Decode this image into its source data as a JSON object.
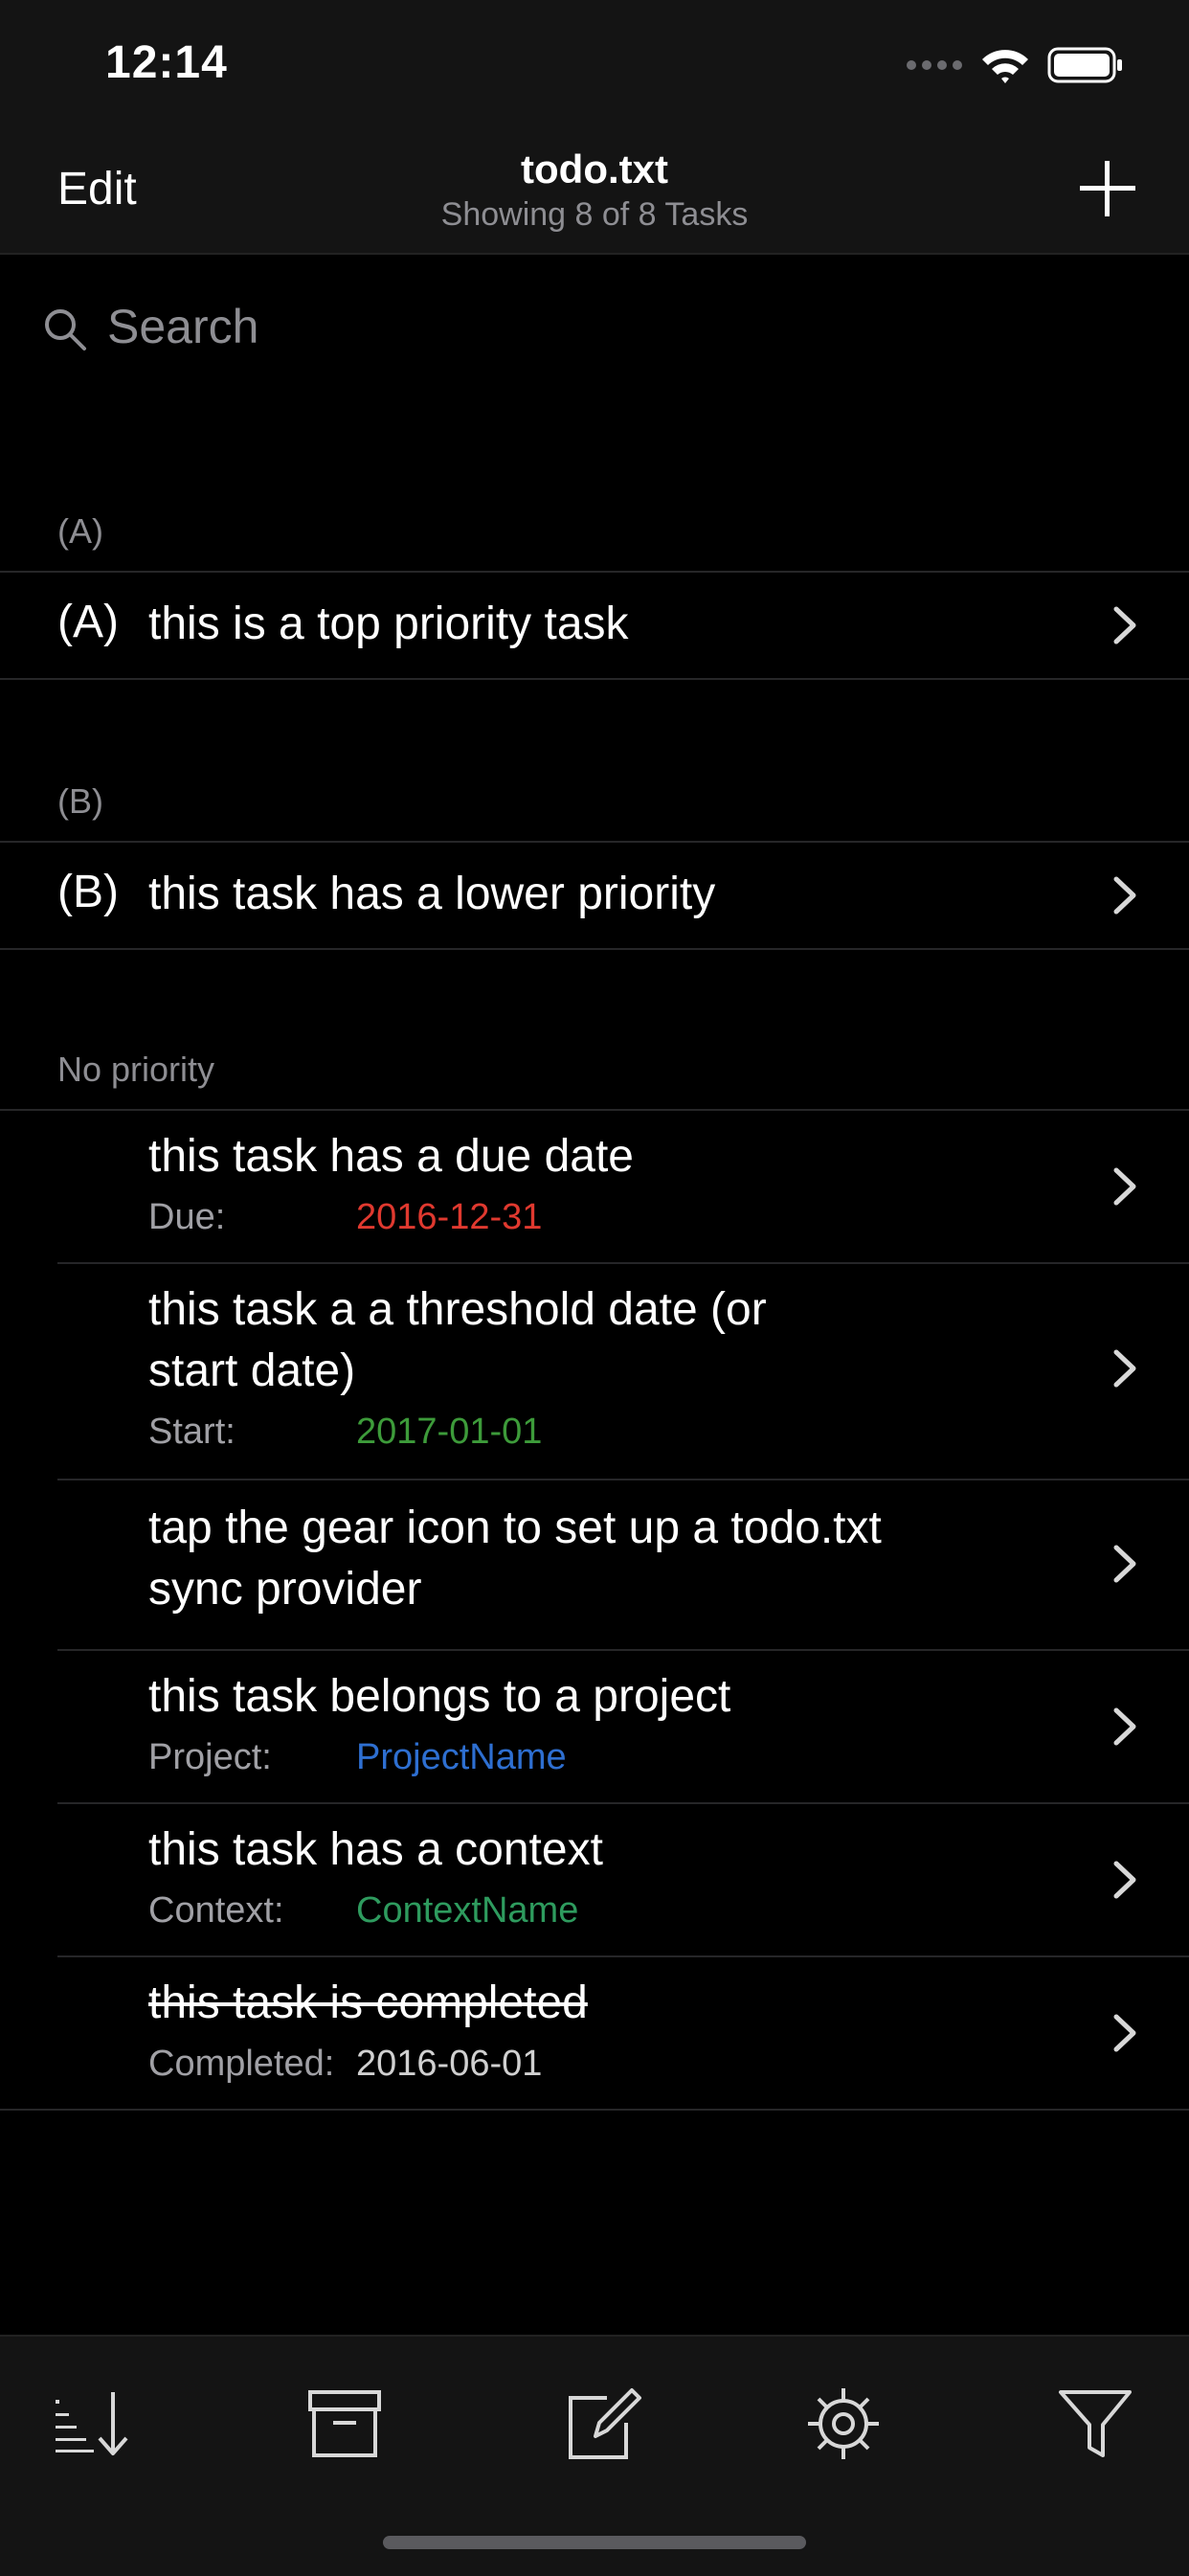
{
  "status_bar": {
    "time": "12:14"
  },
  "nav": {
    "edit_label": "Edit",
    "title": "todo.txt",
    "subtitle": "Showing 8 of 8 Tasks"
  },
  "search": {
    "placeholder": "Search"
  },
  "sections": {
    "a": {
      "header": "(A)",
      "items": [
        {
          "priority": "(A)",
          "text": "this is a top priority task"
        }
      ]
    },
    "b": {
      "header": "(B)",
      "items": [
        {
          "priority": "(B)",
          "text": "this task has a lower priority"
        }
      ]
    },
    "none": {
      "header": "No priority",
      "items": [
        {
          "text": "this task has a due date",
          "meta_label": "Due:",
          "meta_value": "2016-12-31"
        },
        {
          "text_line1": "this task a a threshold date (or",
          "text_line2": "start date)",
          "meta_label": "Start:",
          "meta_value": "2017-01-01"
        },
        {
          "text_line1": "tap the gear icon to set up a todo.txt",
          "text_line2": "sync provider"
        },
        {
          "text": "this task belongs to a project",
          "meta_label": "Project:",
          "meta_value": "ProjectName"
        },
        {
          "text": "this task has a context",
          "meta_label": "Context:",
          "meta_value": "ContextName"
        },
        {
          "text": "this task is completed",
          "meta_label": "Completed:",
          "meta_value": "2016-06-01"
        }
      ]
    }
  },
  "colors": {
    "due": "#e0392f",
    "start": "#3d9b3a",
    "project": "#2e6fd1",
    "context": "#2e9b5e",
    "completed": "#d0d0d0"
  },
  "toolbar": {
    "icons": [
      "sort-icon",
      "archive-icon",
      "compose-icon",
      "gear-icon",
      "filter-icon"
    ]
  }
}
